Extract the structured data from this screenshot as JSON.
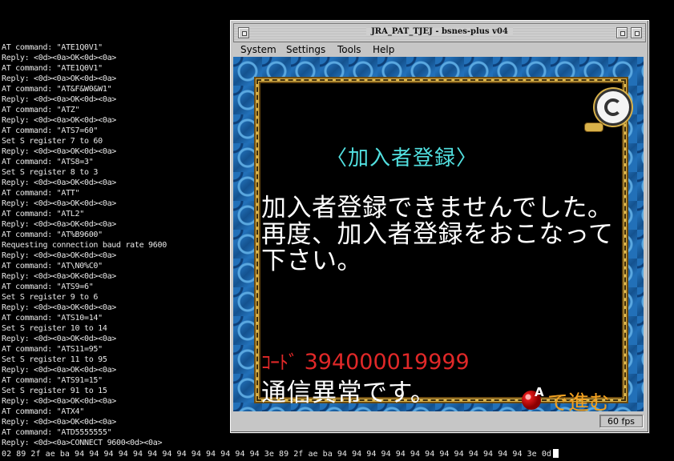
{
  "terminal": {
    "lines": [
      "AT command: \"ATE1Q0V1\"",
      "Reply: <0d><0a>OK<0d><0a>",
      "AT command: \"ATE1Q0V1\"",
      "Reply: <0d><0a>OK<0d><0a>",
      "AT command: \"AT&F&W0&W1\"",
      "Reply: <0d><0a>OK<0d><0a>",
      "AT command: \"ATZ\"",
      "Reply: <0d><0a>OK<0d><0a>",
      "AT command: \"ATS7=60\"",
      "Set S register 7 to 60",
      "Reply: <0d><0a>OK<0d><0a>",
      "AT command: \"ATS8=3\"",
      "Set S register 8 to 3",
      "Reply: <0d><0a>OK<0d><0a>",
      "AT command: \"ATT\"",
      "Reply: <0d><0a>OK<0d><0a>",
      "AT command: \"ATL2\"",
      "Reply: <0d><0a>OK<0d><0a>",
      "AT command: \"AT%B9600\"",
      "Requesting connection baud rate 9600",
      "Reply: <0d><0a>OK<0d><0a>",
      "AT command: \"AT\\N0%C0\"",
      "Reply: <0d><0a>OK<0d><0a>",
      "AT command: \"ATS9=6\"",
      "Set S register 9 to 6",
      "Reply: <0d><0a>OK<0d><0a>",
      "AT command: \"ATS10=14\"",
      "Set S register 10 to 14",
      "Reply: <0d><0a>OK<0d><0a>",
      "AT command: \"ATS11=95\"",
      "Set S register 11 to 95",
      "Reply: <0d><0a>OK<0d><0a>",
      "AT command: \"ATS91=15\"",
      "Set S register 91 to 15",
      "Reply: <0d><0a>OK<0d><0a>",
      "AT command: \"ATX4\"",
      "Reply: <0d><0a>OK<0d><0a>",
      "AT command: \"ATD5555555\"",
      "Reply: <0d><0a>CONNECT 9600<0d><0a>"
    ],
    "hex_line": "02 89 2f ae ba 94 94 94 94 94 94 94 94 94 94 94 94 94 3e 89 2f ae ba 94 94 94 94 94 94 94 94 94 94 94 94 94 3e 0d"
  },
  "window": {
    "title": "JRA_PAT_TJEJ - bsnes-plus v04",
    "menu": [
      "System",
      "Settings",
      "Tools",
      "Help"
    ],
    "status_fps": "60 fps"
  },
  "game": {
    "title": "〈加入者登録〉",
    "message_lines": [
      "加入者登録できませんでした。",
      "再度、加入者登録をおこなって",
      "下さい。"
    ],
    "code_label": "ｺｰﾄﾞ",
    "code_value": "394000019999",
    "error_text": "通信異常です。",
    "button_letter": "A",
    "proceed_text": "で進む"
  },
  "colors": {
    "title_cyan": "#52e0e0",
    "code_red": "#e02828",
    "proceed_orange": "#f0a020",
    "frame_gold": "#d9b24a"
  }
}
